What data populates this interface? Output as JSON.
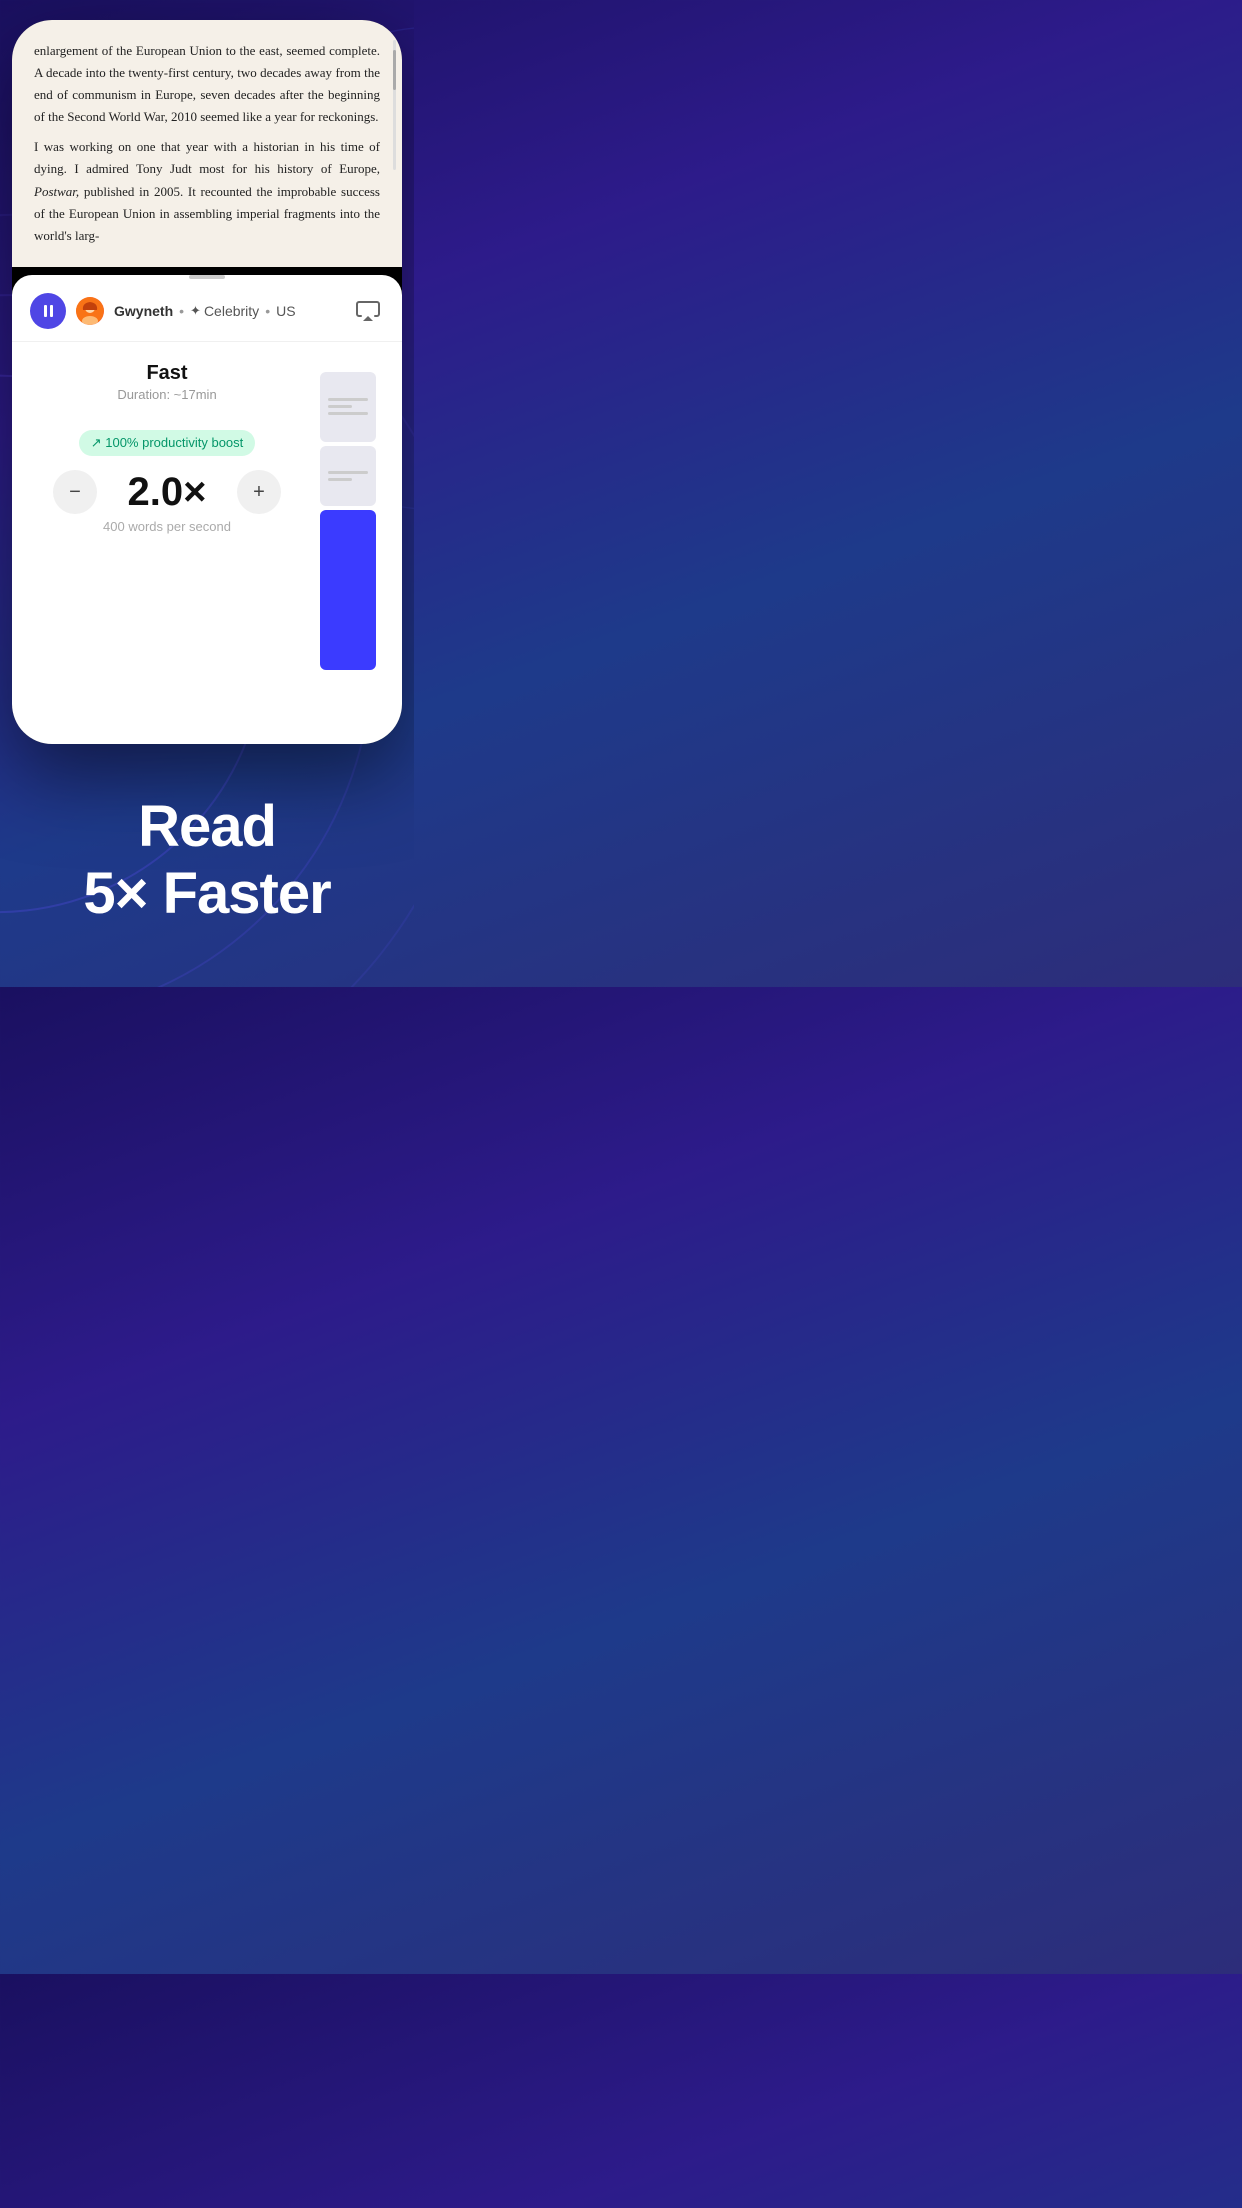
{
  "background": {
    "colors": [
      "#1a1060",
      "#2d1b8a",
      "#1e3a8a"
    ]
  },
  "book_text": {
    "paragraph1": "enlargement of the European Union to the east, seemed complete. A decade into the twenty-first century, two decades away from the end of communism in Europe, seven decades after the beginning of the Second World War, 2010 seemed like a year for reckonings.",
    "paragraph2": "I was working on one that year with a historian in his time of dying. I admired Tony Judt most for his history of Europe, Postwar, published in 2005. It recounted the improbable success of the European Union in assembling imperial fragments into the world's larg-"
  },
  "voice_bar": {
    "voice_name": "Gwyneth",
    "dot1": "•",
    "voice_category": "Celebrity",
    "dot2": "•",
    "voice_country": "US",
    "avatar_emoji": "👩"
  },
  "speed_section": {
    "label": "Fast",
    "duration": "Duration: ~17min",
    "productivity_badge": "↗ 100% productivity boost",
    "speed_value": "2.0×",
    "wps_label": "400 words per second",
    "minus_label": "−",
    "plus_label": "+"
  },
  "marketing": {
    "line1": "Read",
    "line2": "5× Faster"
  }
}
